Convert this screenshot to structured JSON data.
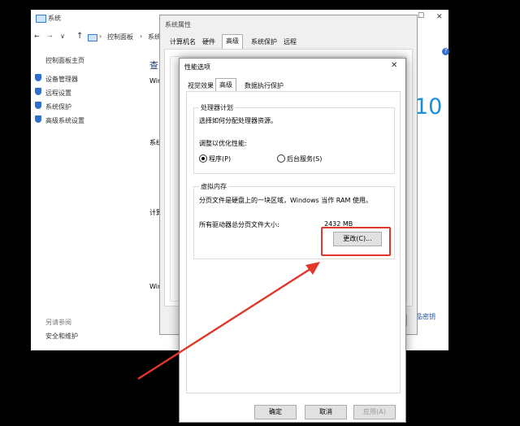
{
  "system_window": {
    "title": "系统",
    "breadcrumb": [
      "控制面板",
      "系统"
    ],
    "sidebar": {
      "home": "控制面板主页",
      "items": [
        "设备管理器",
        "远程设置",
        "系统保护",
        "高级系统设置"
      ],
      "see_also_title": "另请参阅",
      "see_also_items": [
        "安全和维护"
      ]
    },
    "main": {
      "heading_partial": "查",
      "labels_partial": [
        "Win",
        "系统",
        "计算",
        "Win"
      ],
      "win_logo_text": "10",
      "product_key_text": "品密钥"
    }
  },
  "properties_dialog": {
    "title": "系统属性",
    "tabs": [
      "计算机名",
      "硬件",
      "高级",
      "系统保护",
      "远程"
    ],
    "active_tab": "高级"
  },
  "performance_dialog": {
    "title": "性能选项",
    "tabs": [
      "视觉效果",
      "高级",
      "数据执行保护"
    ],
    "active_tab": "高级",
    "processor_group": {
      "title": "处理器计划",
      "description": "选择如何分配处理器资源。",
      "optimize_label": "调整以优化性能:",
      "options": [
        "程序(P)",
        "后台服务(S)"
      ],
      "selected": "程序(P)"
    },
    "virtual_memory_group": {
      "title": "虚拟内存",
      "description": "分页文件是硬盘上的一块区域，Windows 当作 RAM 使用。",
      "total_label": "所有驱动器总分页文件大小:",
      "total_value": "2432 MB",
      "change_button": "更改(C)..."
    },
    "buttons": {
      "ok": "确定",
      "cancel": "取消",
      "apply": "应用(A)"
    }
  },
  "colors": {
    "annotation_red": "#e0392b",
    "link_blue": "#1a4a9c"
  }
}
